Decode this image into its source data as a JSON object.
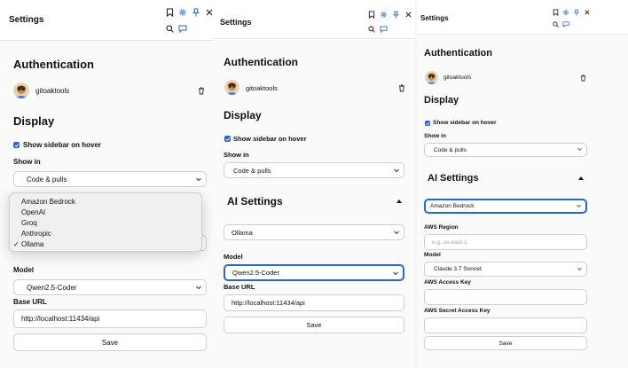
{
  "header": {
    "title": "Settings"
  },
  "icons": [
    "bookmark-icon",
    "gear-icon",
    "pin-icon",
    "close-icon",
    "search-icon",
    "chat-icon"
  ],
  "auth": {
    "heading": "Authentication",
    "username": "gitoaktools"
  },
  "display": {
    "heading": "Display",
    "show_sidebar_label": "Show sidebar on hover",
    "show_sidebar_checked": true,
    "show_in_label": "Show in",
    "show_in_value": "Code & pulls"
  },
  "ai": {
    "heading": "AI Settings",
    "providers": [
      "Amazon Bedrock",
      "OpenAI",
      "Groq",
      "Anthropic",
      "Ollama"
    ],
    "selected_provider": "Ollama",
    "model_label": "Model",
    "model_value": "Qwen2.5-Coder",
    "base_url_label": "Base URL",
    "base_url_value": "http://localhost:11434/api",
    "save_label": "Save"
  },
  "bedrock": {
    "provider_value": "Amazon Bedrock",
    "region_label": "AWS Region",
    "region_placeholder": "e.g. us-east-1",
    "model_label": "Model",
    "model_value": "Claude 3.7 Sonnet",
    "access_key_label": "AWS Access Key",
    "secret_key_label": "AWS Secret Access Key",
    "save_label": "Save"
  },
  "colors": {
    "accent": "#2563eb",
    "panel_bg": "#fafafa"
  }
}
